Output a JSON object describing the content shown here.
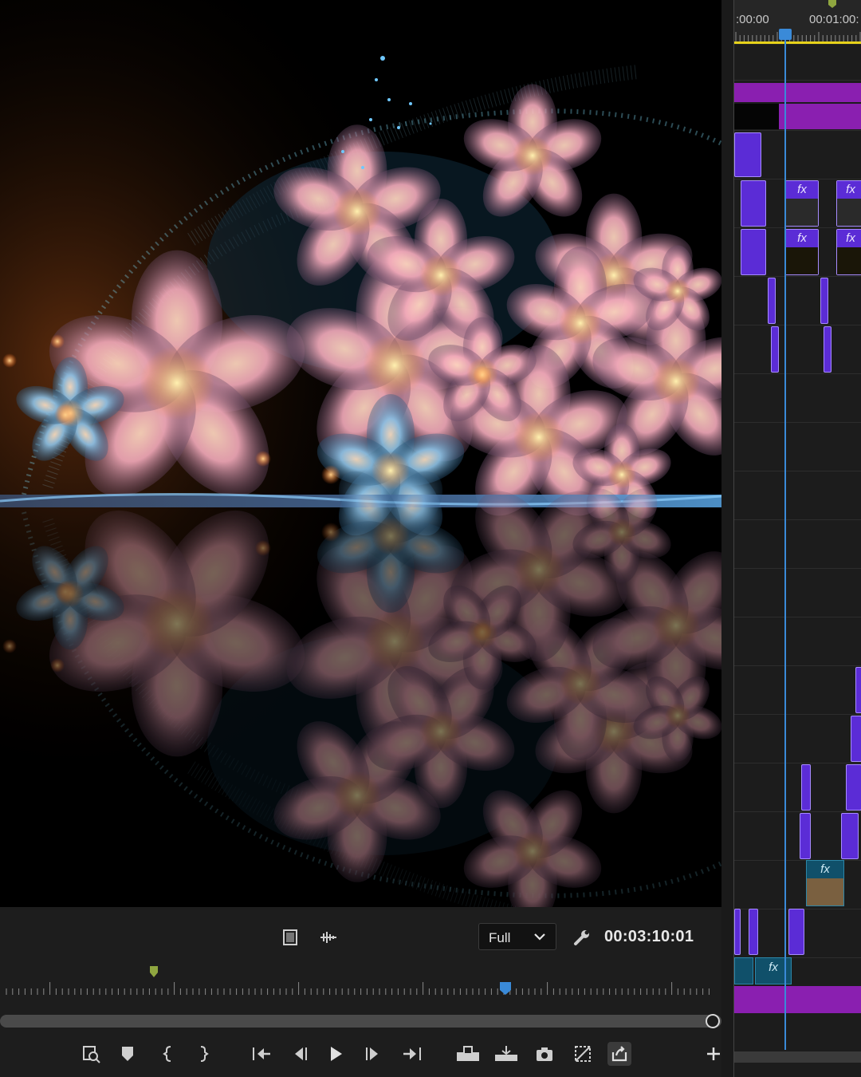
{
  "monitor": {
    "zoom_select": {
      "value": "Full"
    },
    "timecode": "00:03:10:01",
    "icons": [
      "safe-margins-icon",
      "audio-scrub-icon",
      "settings-wrench-icon"
    ]
  },
  "transport": {
    "buttons": [
      "zoom-fit-icon",
      "add-marker-icon",
      "mark-in-icon",
      "mark-out-icon",
      "go-to-in-icon",
      "step-back-icon",
      "play-icon",
      "step-forward-icon",
      "go-to-out-icon",
      "insert-icon",
      "overwrite-icon",
      "export-frame-icon",
      "comparison-view-icon",
      "share-icon",
      "add-button-icon"
    ]
  },
  "timeline": {
    "ruler": {
      "start": ":00:00",
      "next": "00:01:00:"
    },
    "fx_label": "fx"
  },
  "colors": {
    "clip_video": "#5b2cd6",
    "clip_purple": "#8a1fb0",
    "clip_teal": "#10506a",
    "playhead": "#3a8ad8",
    "work_area": "#e7d21a"
  }
}
